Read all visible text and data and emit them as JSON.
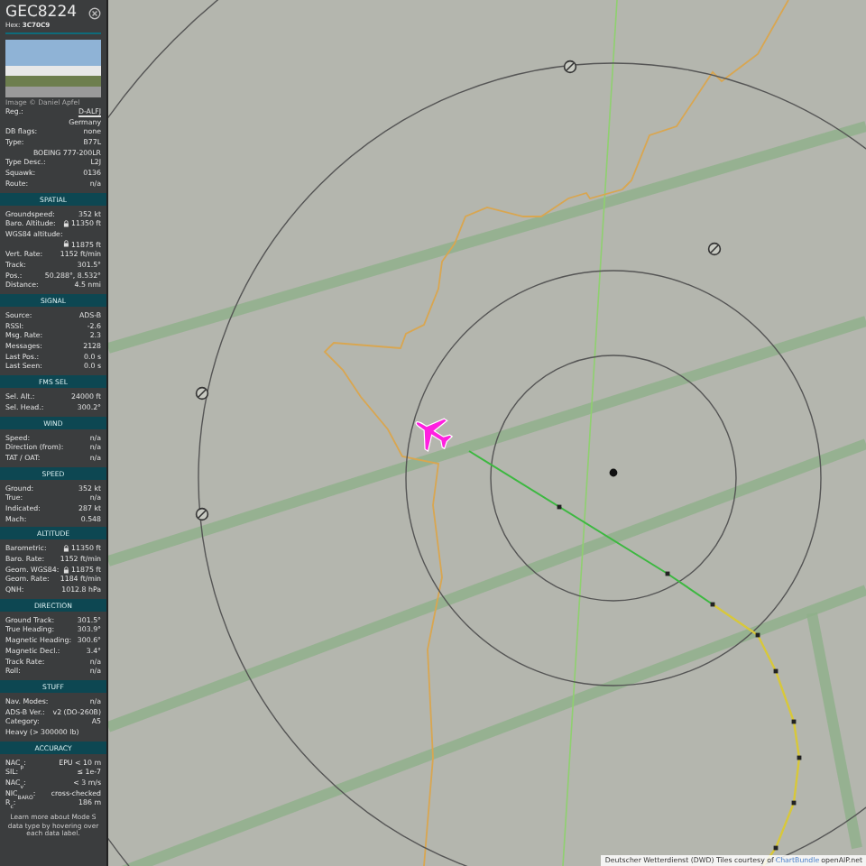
{
  "sidebar": {
    "callsign": "GEC8224",
    "hex_label": "Hex:",
    "hex": "3C70C9",
    "photo_credit": "Image © Daniel Apfel",
    "sections": [
      {
        "rows": [
          {
            "label": "Reg.:",
            "value": "D-ALFJ",
            "link": true
          },
          {
            "value": "Germany"
          },
          {
            "label": "DB flags:",
            "value": "none"
          },
          {
            "label": "Type:",
            "value": "B77L"
          },
          {
            "value": "BOEING 777-200LR"
          },
          {
            "label": "Type Desc.:",
            "value": "L2J"
          },
          {
            "label": "Squawk:",
            "value": "0136"
          },
          {
            "label": "Route:",
            "value": "n/a"
          }
        ]
      },
      {
        "header": "SPATIAL",
        "rows": [
          {
            "label": "Groundspeed:",
            "value": "352 kt"
          },
          {
            "label": "Baro. Altitude:",
            "value": "11350 ft",
            "lock": true
          },
          {
            "label": "WGS84 altitude:"
          },
          {
            "value": "11875 ft",
            "lock": true
          },
          {
            "label": "Vert. Rate:",
            "value": "1152 ft/min"
          },
          {
            "label": "Track:",
            "value": "301.5°"
          },
          {
            "label": "Pos.:",
            "value": "50.288°, 8.532°"
          },
          {
            "label": "Distance:",
            "value": "4.5 nmi"
          }
        ]
      },
      {
        "header": "SIGNAL",
        "rows": [
          {
            "label": "Source:",
            "value": "ADS-B"
          },
          {
            "label": "RSSI:",
            "value": "-2.6"
          },
          {
            "label": "Msg. Rate:",
            "value": "2.3"
          },
          {
            "label": "Messages:",
            "value": "2128"
          },
          {
            "label": "Last Pos.:",
            "value": "0.0 s"
          },
          {
            "label": "Last Seen:",
            "value": "0.0 s"
          }
        ]
      },
      {
        "header": "FMS SEL",
        "rows": [
          {
            "label": "Sel. Alt.:",
            "value": "24000 ft"
          },
          {
            "label": "Sel. Head.:",
            "value": "300.2°"
          }
        ]
      },
      {
        "header": "WIND",
        "rows": [
          {
            "label": "Speed:",
            "value": "n/a"
          },
          {
            "label": "Direction (from):",
            "value": "n/a"
          },
          {
            "label": "TAT / OAT:",
            "value": "n/a"
          }
        ]
      },
      {
        "header": "SPEED",
        "rows": [
          {
            "label": "Ground:",
            "value": "352 kt"
          },
          {
            "label": "True:",
            "value": "n/a"
          },
          {
            "label": "Indicated:",
            "value": "287 kt"
          },
          {
            "label": "Mach:",
            "value": "0.548"
          }
        ]
      },
      {
        "header": "ALTITUDE",
        "rows": [
          {
            "label": "Barometric:",
            "value": "11350 ft",
            "lock": true
          },
          {
            "label": "Baro. Rate:",
            "value": "1152 ft/min"
          },
          {
            "label": "Geom. WGS84:",
            "value": "11875 ft",
            "lock": true
          },
          {
            "label": "Geom. Rate:",
            "value": "1184 ft/min"
          },
          {
            "label": "QNH:",
            "value": "1012.8 hPa"
          }
        ]
      },
      {
        "header": "DIRECTION",
        "rows": [
          {
            "label": "Ground Track:",
            "value": "301.5°"
          },
          {
            "label": "True Heading:",
            "value": "303.9°"
          },
          {
            "label": "Magnetic Heading:",
            "value": "300.6°"
          },
          {
            "label": "Magnetic Decl.:",
            "value": "3.4°"
          },
          {
            "label": "Track Rate:",
            "value": "n/a"
          },
          {
            "label": "Roll:",
            "value": "n/a"
          }
        ]
      },
      {
        "header": "STUFF",
        "rows": [
          {
            "label": "Nav. Modes:",
            "value": "n/a"
          },
          {
            "label": "ADS-B Ver.:",
            "value": "v2 (DO-260B)"
          },
          {
            "label": "Category:",
            "value": "A5"
          },
          {
            "label": "Heavy (> 300000 lb)"
          }
        ]
      },
      {
        "header": "ACCURACY",
        "rows": [
          {
            "label": "NAC$_{p}$:",
            "value": "EPU < 10 m"
          },
          {
            "label": "SIL:",
            "value": "≤ 1e-7"
          },
          {
            "label": "NAC$_{v}$:",
            "value": "< 3 m/s"
          },
          {
            "label": "NIC$_{BARO}$:",
            "value": "cross-checked"
          },
          {
            "label": "R$_{c}$:",
            "value": "186 m"
          }
        ]
      }
    ],
    "footer": "Learn more about Mode S data type by hovering over each data label."
  },
  "map": {
    "attribution": "Deutscher Wetterdienst (DWD) Tiles courtesy of",
    "attribution_link": "ChartBundle",
    "attribution_tail": "openAIP.net"
  }
}
